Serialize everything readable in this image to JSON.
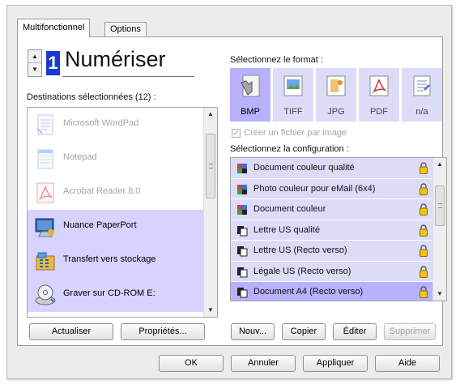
{
  "tabs": [
    "Multifonctionnel",
    "Options"
  ],
  "scan": {
    "number": "1",
    "label": "Numériser"
  },
  "destinations": {
    "heading": "Destinations sélectionnées (12) :",
    "items": [
      {
        "label": "Microsoft WordPad",
        "icon": "wordpad-icon"
      },
      {
        "label": "Notepad",
        "icon": "notepad-icon"
      },
      {
        "label": "Acrobat Reader 8.0",
        "icon": "acrobat-icon"
      },
      {
        "label": "Nuance PaperPort",
        "icon": "paperport-icon"
      },
      {
        "label": "Transfert vers stockage",
        "icon": "storage-icon"
      },
      {
        "label": "Graver sur CD-ROM  E:",
        "icon": "cd-burn-icon"
      }
    ],
    "refresh_button": "Actualiser",
    "properties_button": "Propriétés..."
  },
  "format": {
    "heading": "Sélectionnez le format :",
    "items": [
      {
        "label": "BMP",
        "icon": "bmp-icon"
      },
      {
        "label": "TIFF",
        "icon": "tiff-icon"
      },
      {
        "label": "JPG",
        "icon": "jpg-icon"
      },
      {
        "label": "PDF",
        "icon": "pdf-icon"
      },
      {
        "label": "n/a",
        "icon": "text-icon"
      }
    ],
    "checkbox_label": "Créer un fichier par image"
  },
  "configuration": {
    "heading": "Sélectionnez la configuration :",
    "items": [
      {
        "label": "Document couleur qualité"
      },
      {
        "label": "Photo couleur pour eMail (6x4)"
      },
      {
        "label": "Document couleur"
      },
      {
        "label": "Lettre US qualité"
      },
      {
        "label": "Lettre US (Recto verso)"
      },
      {
        "label": "Légale US (Recto verso)"
      },
      {
        "label": "Document A4 (Recto verso)"
      }
    ],
    "new_button": "Nouv...",
    "copy_button": "Copier",
    "edit_button": "Éditer",
    "delete_button": "Supprimer"
  },
  "footer": {
    "ok_button": "OK",
    "cancel_button": "Annuler",
    "apply_button": "Appliquer",
    "help_button": "Aide"
  },
  "colors": {
    "selection": "#b7b1ff",
    "list_bg": "#dcdcf9",
    "digit_bg": "#1a3bd0"
  }
}
